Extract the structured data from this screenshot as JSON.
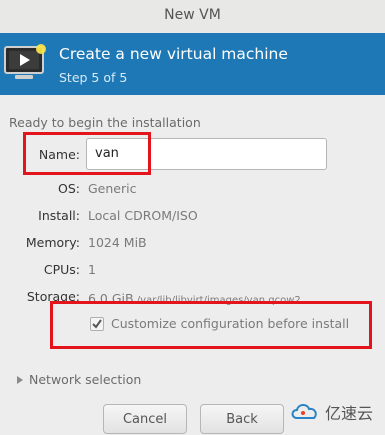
{
  "window": {
    "title": "New VM"
  },
  "banner": {
    "title": "Create a new virtual machine",
    "step": "Step 5 of 5",
    "icon": "monitor-play-icon"
  },
  "intro": "Ready to begin the installation",
  "fields": {
    "name": {
      "label": "Name:",
      "value": "van"
    },
    "os": {
      "label": "OS:",
      "value": "Generic"
    },
    "install": {
      "label": "Install:",
      "value": "Local CDROM/ISO"
    },
    "memory": {
      "label": "Memory:",
      "value": "1024 MiB"
    },
    "cpus": {
      "label": "CPUs:",
      "value": "1"
    },
    "storage": {
      "label": "Storage:",
      "size": "6.0 GiB",
      "path": "/var/lib/libvirt/images/van.qcow2"
    }
  },
  "customize": {
    "label": "Customize configuration before install",
    "checked": true
  },
  "network": {
    "label": "Network selection",
    "icon": "expander-arrow-icon"
  },
  "buttons": {
    "cancel": "Cancel",
    "back": "Back"
  },
  "watermark": {
    "text": "亿速云"
  },
  "colors": {
    "banner": "#1e78b6",
    "highlight": "#e3141c"
  }
}
